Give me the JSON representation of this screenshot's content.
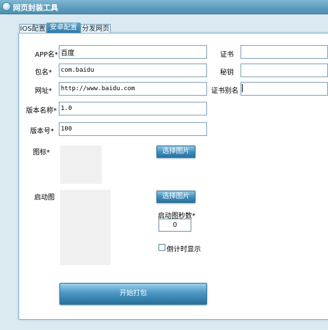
{
  "window": {
    "title": "网页封装工具"
  },
  "tabs": [
    {
      "label": "IOS配置"
    },
    {
      "label": "安卓配置"
    },
    {
      "label": "分发网页"
    }
  ],
  "form": {
    "app_name": {
      "label": "APP名*",
      "value": "百度"
    },
    "package": {
      "label": "包名*",
      "value": "com.baidu"
    },
    "url": {
      "label": "网址*",
      "value": "http://www.baidu.com"
    },
    "version_name": {
      "label": "版本名称*",
      "value": "1.0"
    },
    "version_code": {
      "label": "版本号*",
      "value": "100"
    },
    "icon": {
      "label": "图标*",
      "button": "选择图片"
    },
    "splash": {
      "label": "启动图",
      "button": "选择图片",
      "seconds_label": "启动图秒数*",
      "seconds_value": "0",
      "countdown_label": "倒计时显示"
    },
    "certificate": {
      "label": "证书",
      "value": ""
    },
    "secret_key": {
      "label": "秘钥",
      "value": ""
    },
    "cert_alias": {
      "label": "证书别名",
      "value": ""
    },
    "submit": "开始打包"
  }
}
